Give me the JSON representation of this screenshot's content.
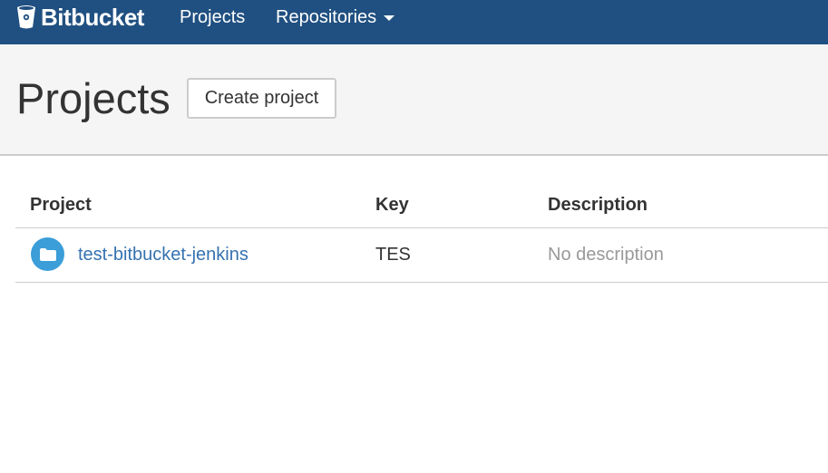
{
  "app": {
    "brand": "Bitbucket"
  },
  "nav": {
    "projects_label": "Projects",
    "repositories_label": "Repositories"
  },
  "header": {
    "title": "Projects",
    "create_button_label": "Create project"
  },
  "table": {
    "columns": [
      "Project",
      "Key",
      "Description"
    ],
    "rows": [
      {
        "name": "test-bitbucket-jenkins",
        "key": "TES",
        "description": "No description",
        "icon": "folder-icon"
      }
    ]
  },
  "colors": {
    "topbar": "#205081",
    "link": "#3572b0",
    "avatar": "#3b9ed8",
    "muted": "#999999"
  }
}
